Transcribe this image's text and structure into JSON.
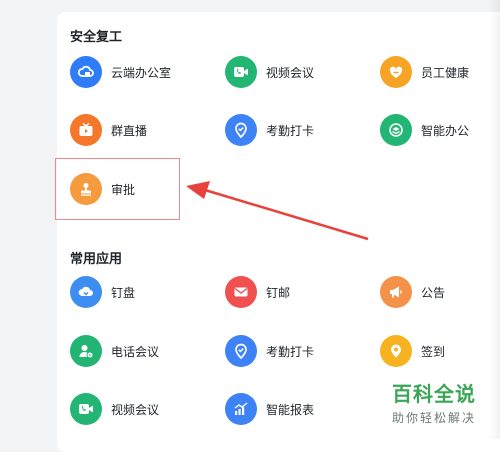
{
  "sections": [
    {
      "title": "安全复工",
      "apps": [
        {
          "label": "云端办公室",
          "icon": "cloud-office-icon",
          "color": "#2e7cf6"
        },
        {
          "label": "视频会议",
          "icon": "video-call-icon",
          "color": "#22b573"
        },
        {
          "label": "员工健康",
          "icon": "heart-icon",
          "color": "#f7a325"
        },
        {
          "label": "群直播",
          "icon": "live-tv-icon",
          "color": "#f5772b"
        },
        {
          "label": "考勤打卡",
          "icon": "location-check-icon",
          "color": "#3d82f6"
        },
        {
          "label": "智能办公",
          "icon": "smart-office-icon",
          "color": "#22b573"
        },
        {
          "label": "审批",
          "icon": "stamp-icon",
          "color": "#f59a3d"
        }
      ]
    },
    {
      "title": "常用应用",
      "apps": [
        {
          "label": "钉盘",
          "icon": "cloud-disk-icon",
          "color": "#3d8ef0"
        },
        {
          "label": "钉邮",
          "icon": "mail-icon",
          "color": "#f05050"
        },
        {
          "label": "公告",
          "icon": "megaphone-icon",
          "color": "#f5924a"
        },
        {
          "label": "电话会议",
          "icon": "phone-meeting-icon",
          "color": "#22b573"
        },
        {
          "label": "考勤打卡",
          "icon": "location-check-icon",
          "color": "#3d82f6"
        },
        {
          "label": "签到",
          "icon": "location-pin-icon",
          "color": "#f7b21f"
        },
        {
          "label": "视频会议",
          "icon": "video-call-icon",
          "color": "#22b573"
        },
        {
          "label": "智能报表",
          "icon": "chart-report-icon",
          "color": "#3d82f6"
        }
      ]
    }
  ],
  "watermark": {
    "main": "百科全说",
    "sub": "助你轻松解决"
  }
}
